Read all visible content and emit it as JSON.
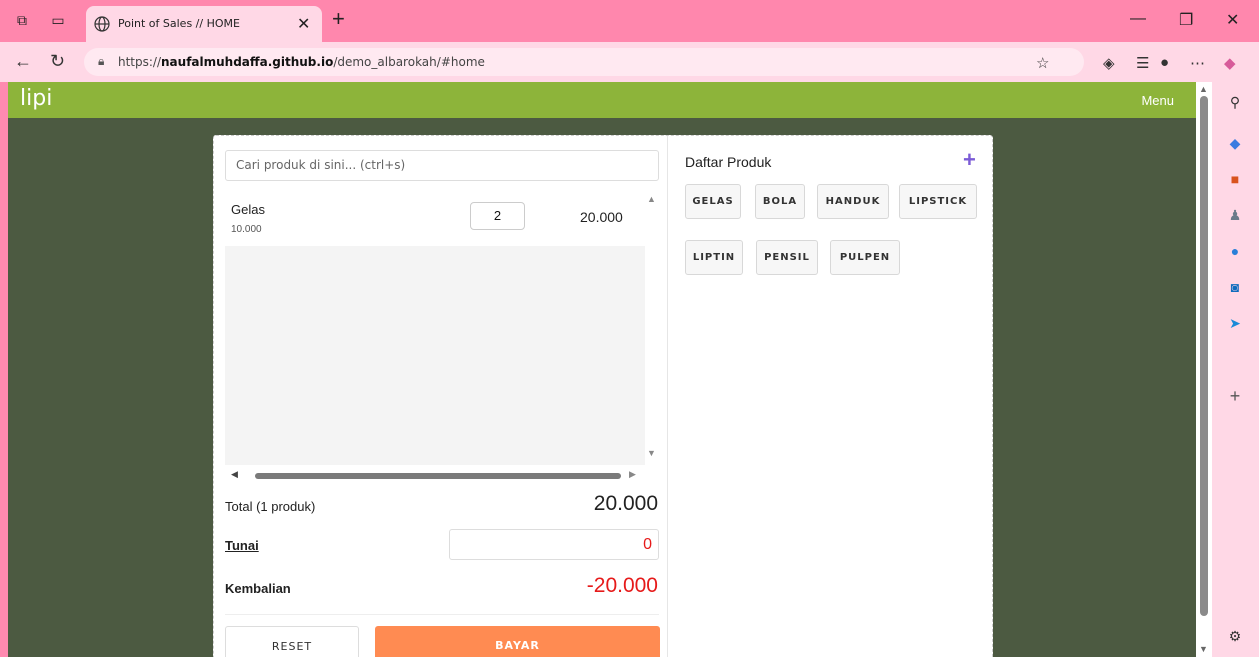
{
  "browser": {
    "tab_title": "Point of Sales // HOME",
    "url_prefix": "https://",
    "url_host": "naufalmuhdaffa.github.io",
    "url_path": "/demo_albarokah/#home"
  },
  "app": {
    "brand": "lipi",
    "menu_label": "Menu"
  },
  "search": {
    "placeholder": "Cari produk di sini... (ctrl+s)"
  },
  "cart": {
    "items": [
      {
        "name": "Gelas",
        "unit_price": "10.000",
        "qty": "2",
        "line_total": "20.000"
      }
    ]
  },
  "summary": {
    "total_label": "Total (1 produk)",
    "total_value": "20.000",
    "tunai_label": "Tunai",
    "tunai_value": "0",
    "kembalian_label": "Kembalian",
    "kembalian_value": "-20.000"
  },
  "actions": {
    "reset_label": "RESET",
    "bayar_label": "BAYAR"
  },
  "products": {
    "title": "Daftar Produk",
    "add_icon": "+",
    "items": [
      "GELAS",
      "BOLA",
      "HANDUK",
      "LIPSTICK",
      "LIPTIN",
      "PENSIL",
      "PULPEN"
    ]
  },
  "colors": {
    "appbar": "#8db43a",
    "background": "#4c5a41",
    "bayar": "#ff8b52",
    "negative": "#e61a1a",
    "accent": "#7b5bd6"
  }
}
